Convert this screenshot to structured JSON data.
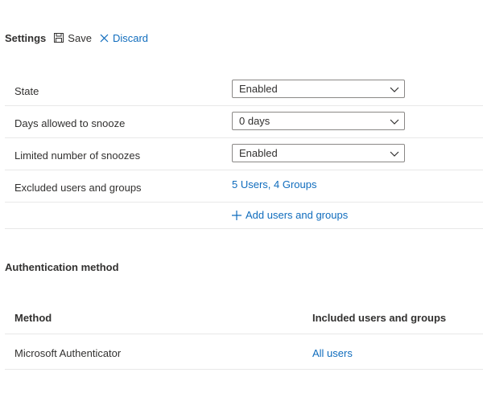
{
  "toolbar": {
    "title": "Settings",
    "save_label": "Save",
    "discard_label": "Discard",
    "icons": {
      "save": "save-icon",
      "discard": "close-icon"
    }
  },
  "settings": {
    "rows": [
      {
        "label": "State",
        "value": "Enabled"
      },
      {
        "label": "Days allowed to snooze",
        "value": "0 days"
      },
      {
        "label": "Limited number of snoozes",
        "value": "Enabled"
      },
      {
        "label": "Excluded users and groups",
        "link": "5 Users, 4 Groups"
      }
    ],
    "add_link": "Add users and groups"
  },
  "auth": {
    "title": "Authentication method",
    "headers": [
      "Method",
      "Included users and groups"
    ],
    "rows": [
      {
        "method": "Microsoft Authenticator",
        "included": "All users"
      }
    ]
  },
  "colors": {
    "link": "#0f6cbd",
    "text": "#323130",
    "divider": "#e8e8e8"
  }
}
